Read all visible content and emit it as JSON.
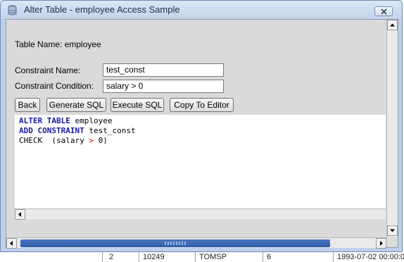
{
  "window": {
    "title": "Alter Table - employee Access Sample"
  },
  "form": {
    "table_name_label": "Table Name: employee",
    "constraint_name_label": "Constraint Name:",
    "constraint_name_value": "test_const",
    "constraint_condition_label": "Constraint Condition:",
    "constraint_condition_value": "salary > 0"
  },
  "buttons": {
    "back": "Back",
    "generate_sql": "Generate SQL",
    "execute_sql": "Execute SQL",
    "copy_to_editor": "Copy To Editor"
  },
  "sql": {
    "line1_kw": "ALTER TABLE",
    "line1_rest": " employee",
    "line2_kw": "ADD CONSTRAINT",
    "line2_rest": " test_const",
    "line3_a": "CHECK  (salary ",
    "line3_op": ">",
    "line3_b": " 0)"
  },
  "background_row": {
    "cells": [
      "2",
      "10249",
      "TOMSP",
      "6",
      "1993-07-02 00:00:0"
    ]
  },
  "colors": {
    "keyword": "#1a1aa6",
    "operator": "#d00000",
    "scroll_thumb": "#2f5da8"
  }
}
